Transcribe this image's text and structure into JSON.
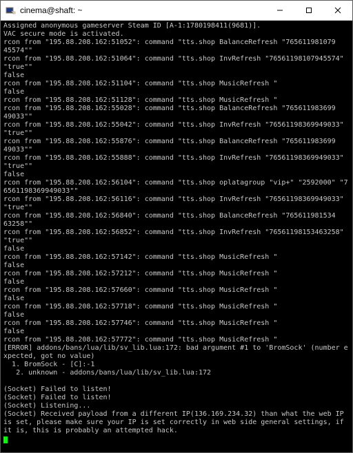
{
  "window": {
    "title": "cinema@shaft: ~"
  },
  "terminal": {
    "lines": [
      "Assigned anonymous gameserver Steam ID [A-1:1780198411(9681)].",
      "VAC secure mode is activated.",
      "rcon from \"195.88.208.162:51052\": command \"tts.shop BalanceRefresh \"765611981079",
      "45574\"\"",
      "rcon from \"195.88.208.162:51064\": command \"tts.shop InvRefresh \"76561198107945574\" \"true\"\"",
      "false",
      "rcon from \"195.88.208.162:51104\": command \"tts.shop MusicRefresh \"",
      "false",
      "rcon from \"195.88.208.162:51128\": command \"tts.shop MusicRefresh \"",
      "rcon from \"195.88.208.162:55028\": command \"tts.shop BalanceRefresh \"765611983699",
      "49033\"\"",
      "rcon from \"195.88.208.162:55042\": command \"tts.shop InvRefresh \"76561198369949033\" \"true\"\"",
      "rcon from \"195.88.208.162:55876\": command \"tts.shop BalanceRefresh \"765611983699",
      "49033\"\"",
      "rcon from \"195.88.208.162:55888\": command \"tts.shop InvRefresh \"76561198369949033\" \"true\"\"",
      "false",
      "rcon from \"195.88.208.162:56104\": command \"tts.shop oplatagroup \"vip+\" \"2592000\" \"76561198369949033\"\"",
      "rcon from \"195.88.208.162:56116\": command \"tts.shop InvRefresh \"76561198369949033\" \"true\"\"",
      "rcon from \"195.88.208.162:56840\": command \"tts.shop BalanceRefresh \"765611981534",
      "63258\"\"",
      "rcon from \"195.88.208.162:56852\": command \"tts.shop InvRefresh \"76561198153463258\" \"true\"\"",
      "false",
      "rcon from \"195.88.208.162:57142\": command \"tts.shop MusicRefresh \"",
      "false",
      "rcon from \"195.88.208.162:57212\": command \"tts.shop MusicRefresh \"",
      "false",
      "rcon from \"195.88.208.162:57660\": command \"tts.shop MusicRefresh \"",
      "false",
      "rcon from \"195.88.208.162:57718\": command \"tts.shop MusicRefresh \"",
      "false",
      "rcon from \"195.88.208.162:57746\": command \"tts.shop MusicRefresh \"",
      "false",
      "rcon from \"195.88.208.162:57772\": command \"tts.shop MusicRefresh \"",
      "[ERROR] addons/bans/lua/lib/sv_lib.lua:172: bad argument #1 to 'BromSock' (number expected, got no value)",
      "  1. BromSock - [C]:-1",
      "   2. unknown - addons/bans/lua/lib/sv_lib.lua:172",
      "",
      "(Socket) Failed to listen!",
      "(Socket) Failed to listen!",
      "(Socket) Listening...",
      "(Socket) Received payload from a different IP(136.169.234.32) than what the web IP is set, please make sure your IP is set correctly in web side general settings, if it is, this is probably an attempted hack."
    ]
  }
}
